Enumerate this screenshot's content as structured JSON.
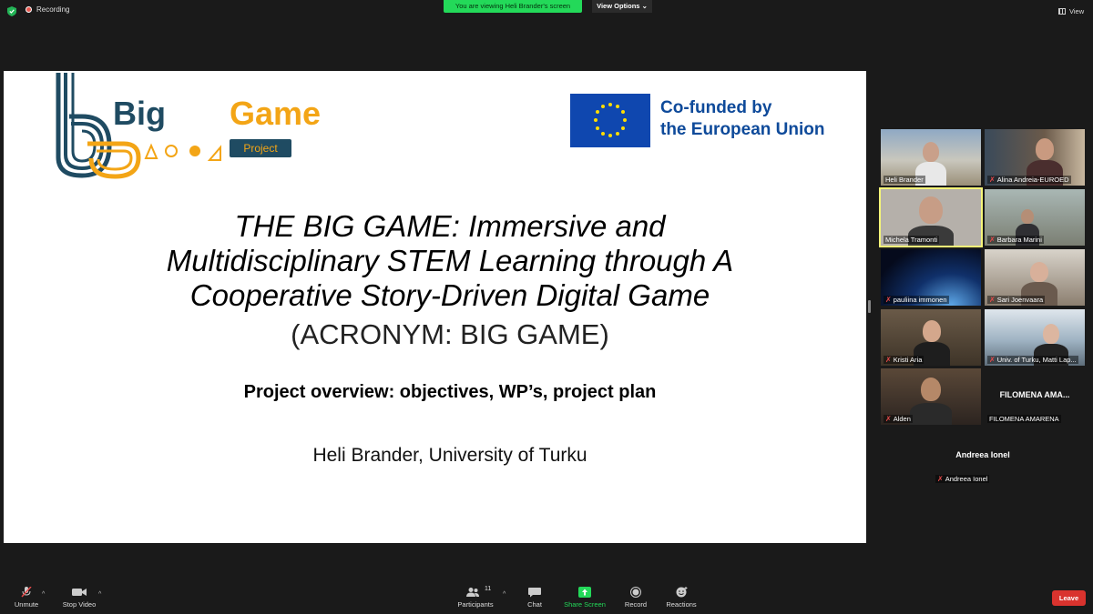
{
  "top_bar": {
    "recording_label": "Recording",
    "share_banner": "You are viewing Heli Brander's screen",
    "view_options": "View Options",
    "view_label": "View"
  },
  "slide": {
    "logo_big": "Big",
    "logo_game": "Game",
    "logo_project": "Project",
    "eu_line1": "Co-funded by",
    "eu_line2": "the European Union",
    "title_line1": "THE BIG GAME: Immersive and",
    "title_line2": "Multidisciplinary STEM Learning through A",
    "title_line3": "Cooperative Story-Driven Digital Game",
    "acronym": "(ACRONYM: BIG GAME)",
    "overview": "Project overview: objectives, WP’s, project plan",
    "author": "Heli Brander, University of Turku"
  },
  "participants": [
    {
      "name": "Heli Brander",
      "muted": false
    },
    {
      "name": "Alina Andreia-EUROED",
      "muted": true
    },
    {
      "name": "Michela Tramonti",
      "muted": false
    },
    {
      "name": "Barbara Marini",
      "muted": true
    },
    {
      "name": "pauliina immonen",
      "muted": true
    },
    {
      "name": "Sari Joenvaara",
      "muted": true
    },
    {
      "name": "Kristi Aria",
      "muted": true
    },
    {
      "name": "Univ. of Turku, Matti Lap...",
      "muted": true
    },
    {
      "name": "Alden",
      "muted": true
    },
    {
      "name": "FILOMENA AMARENA",
      "display": "FILOMENA AMA...",
      "muted": false
    },
    {
      "name": "Andreea Ionel",
      "display": "Andreea Ionel",
      "muted": true
    }
  ],
  "toolbar": {
    "unmute": "Unmute",
    "stop_video": "Stop Video",
    "participants": "Participants",
    "participants_count": "11",
    "chat": "Chat",
    "share_screen": "Share Screen",
    "record": "Record",
    "reactions": "Reactions",
    "leave": "Leave"
  },
  "colors": {
    "banner_green": "#23d959",
    "leave_red": "#d9332e",
    "active_speaker": "#f5f578",
    "eu_blue": "#0f47af",
    "logo_navy": "#1f4b62",
    "logo_orange": "#f3a516"
  }
}
